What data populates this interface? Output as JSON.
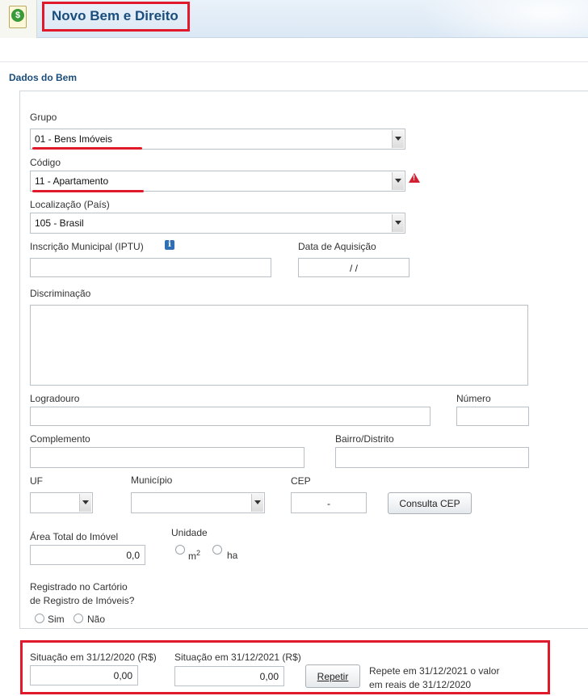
{
  "header": {
    "title": "Novo Bem e Direito",
    "icon": "dollar-document-icon"
  },
  "section": {
    "title": "Dados do Bem"
  },
  "form": {
    "grupo_label": "Grupo",
    "grupo_value": "01 - Bens Imóveis",
    "codigo_label": "Código",
    "codigo_value": "11 - Apartamento",
    "localizacao_label": "Localização (País)",
    "localizacao_value": "105 - Brasil",
    "iptu_label": "Inscrição Municipal (IPTU)",
    "iptu_value": "",
    "data_aquisicao_label": "Data de Aquisição",
    "data_aquisicao_value": "/ /",
    "discriminacao_label": "Discriminação",
    "discriminacao_value": "",
    "logradouro_label": "Logradouro",
    "numero_label": "Número",
    "complemento_label": "Complemento",
    "bairro_label": "Bairro/Distrito",
    "uf_label": "UF",
    "municipio_label": "Município",
    "cep_label": "CEP",
    "cep_value": "-",
    "consulta_cep_button": "Consulta CEP",
    "area_label": "Área Total do Imóvel",
    "area_value": "0,0",
    "unidade_label": "Unidade",
    "unidade_m2": "m",
    "unidade_m2_sup": "2",
    "unidade_ha": "ha",
    "registrado_label_line1": "Registrado no Cartório",
    "registrado_label_line2": "de Registro de Imóveis?",
    "sim_label": "Sim",
    "nao_label": "Não"
  },
  "situacao": {
    "s2020_label": "Situação em 31/12/2020 (R$)",
    "s2020_value": "0,00",
    "s2021_label": "Situação em 31/12/2021 (R$)",
    "s2021_value": "0,00",
    "repetir_button": "Repetir",
    "repetir_hint_line1": "Repete em 31/12/2021 o valor",
    "repetir_hint_line2": "em reais de 31/12/2020"
  },
  "colors": {
    "highlight": "#e01a2a",
    "title": "#1a4d7c",
    "warning": "#d32030",
    "info": "#2f6fb5"
  }
}
